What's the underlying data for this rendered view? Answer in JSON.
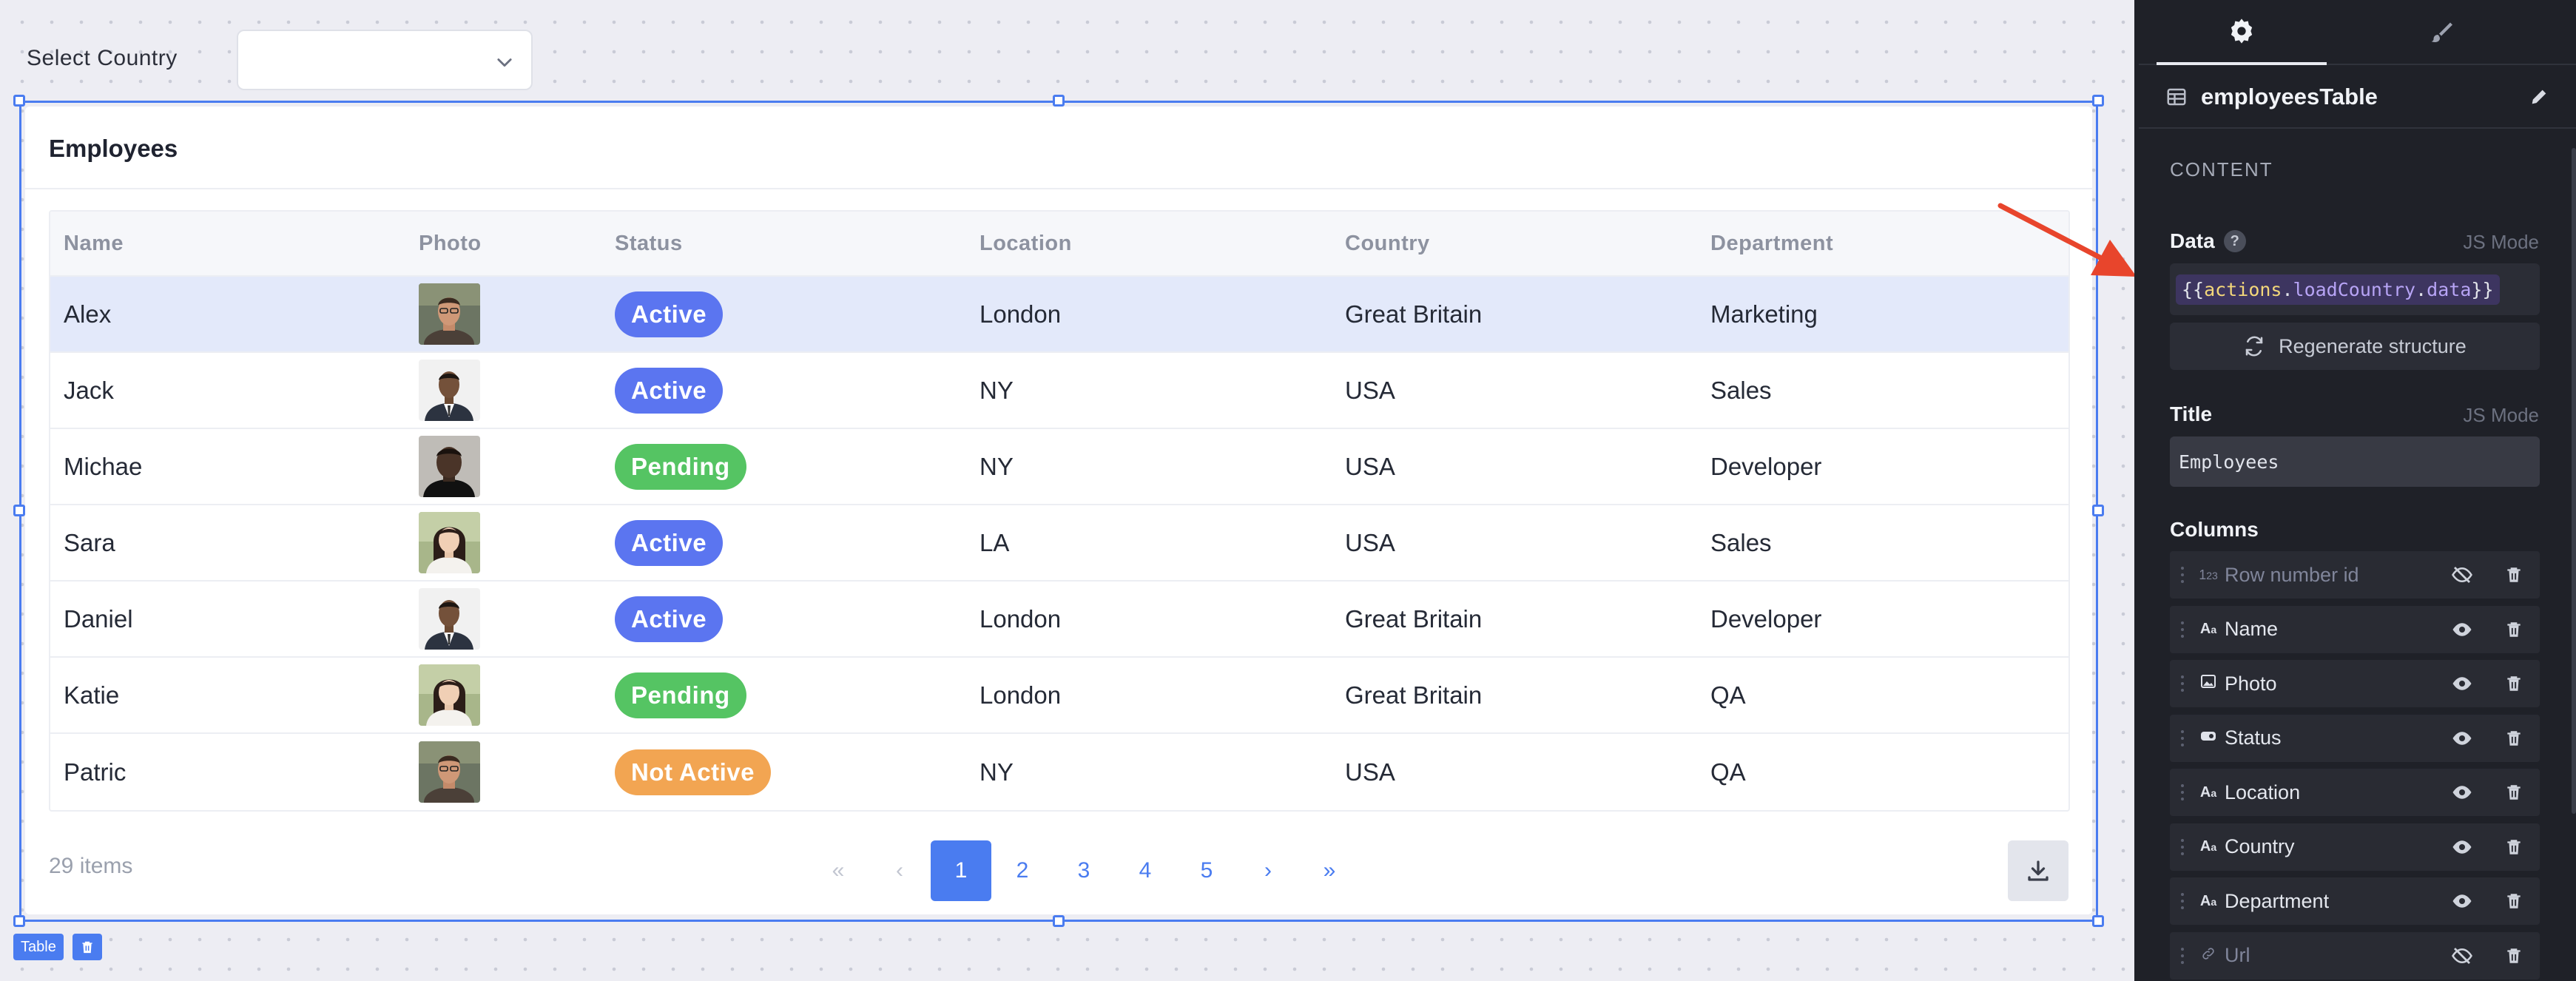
{
  "filter": {
    "label": "Select Country",
    "value": ""
  },
  "table": {
    "title": "Employees",
    "columns": [
      "Name",
      "Photo",
      "Status",
      "Location",
      "Country",
      "Department"
    ],
    "rows": [
      {
        "name": "Alex",
        "photo": "avatar-man-glasses",
        "status": "Active",
        "status_color": "#5b75f0",
        "location": "London",
        "country": "Great Britain",
        "department": "Marketing"
      },
      {
        "name": "Jack",
        "photo": "avatar-man-suit",
        "status": "Active",
        "status_color": "#5b75f0",
        "location": "NY",
        "country": "USA",
        "department": "Sales"
      },
      {
        "name": "Michae",
        "photo": "avatar-man-dark",
        "status": "Pending",
        "status_color": "#55c463",
        "location": "NY",
        "country": "USA",
        "department": "Developer"
      },
      {
        "name": "Sara",
        "photo": "avatar-woman",
        "status": "Active",
        "status_color": "#5b75f0",
        "location": "LA",
        "country": "USA",
        "department": "Sales"
      },
      {
        "name": "Daniel",
        "photo": "avatar-man-suit",
        "status": "Active",
        "status_color": "#5b75f0",
        "location": "London",
        "country": "Great Britain",
        "department": "Developer"
      },
      {
        "name": "Katie",
        "photo": "avatar-woman",
        "status": "Pending",
        "status_color": "#55c463",
        "location": "London",
        "country": "Great Britain",
        "department": "QA"
      },
      {
        "name": "Patric",
        "photo": "avatar-man-glasses",
        "status": "Not Active",
        "status_color": "#f2a552",
        "location": "NY",
        "country": "USA",
        "department": "QA"
      }
    ],
    "item_count": "29 items",
    "pagination": {
      "first": "«",
      "prev": "‹",
      "pages": [
        "1",
        "2",
        "3",
        "4",
        "5"
      ],
      "current_page": "1",
      "next": "›",
      "last": "»"
    },
    "download_icon": "download-icon"
  },
  "widget_tag": {
    "label": "Table"
  },
  "panel": {
    "tabs": [
      {
        "icon": "gear-icon",
        "active": true
      },
      {
        "icon": "brush-icon",
        "active": false
      }
    ],
    "component_name": "employeesTable",
    "section": "CONTENT",
    "data_field": {
      "label": "Data",
      "help": "?",
      "mode": "JS Mode",
      "open": "{{",
      "object": "actions",
      "dot1": ".",
      "member1": "loadCountry",
      "dot2": ".",
      "member2": "data",
      "close": "}}"
    },
    "regenerate_label": "Regenerate structure",
    "title_field": {
      "label": "Title",
      "mode": "JS Mode",
      "value": "Employees"
    },
    "columns_label": "Columns",
    "columns": [
      {
        "name": "Row number id",
        "type_icon": "123",
        "visible": false
      },
      {
        "name": "Name",
        "type_icon": "Aa",
        "visible": true
      },
      {
        "name": "Photo",
        "type_icon": "image",
        "visible": true
      },
      {
        "name": "Status",
        "type_icon": "badge",
        "visible": true
      },
      {
        "name": "Location",
        "type_icon": "Aa",
        "visible": true
      },
      {
        "name": "Country",
        "type_icon": "Aa",
        "visible": true
      },
      {
        "name": "Department",
        "type_icon": "Aa",
        "visible": true
      },
      {
        "name": "Url",
        "type_icon": "link",
        "visible": false
      }
    ]
  },
  "colors": {
    "accent": "#4a7cf0",
    "active": "#5b75f0",
    "pending": "#55c463",
    "not_active": "#f2a552",
    "panel_bg": "#1f2128",
    "arrow": "#e8452c"
  }
}
